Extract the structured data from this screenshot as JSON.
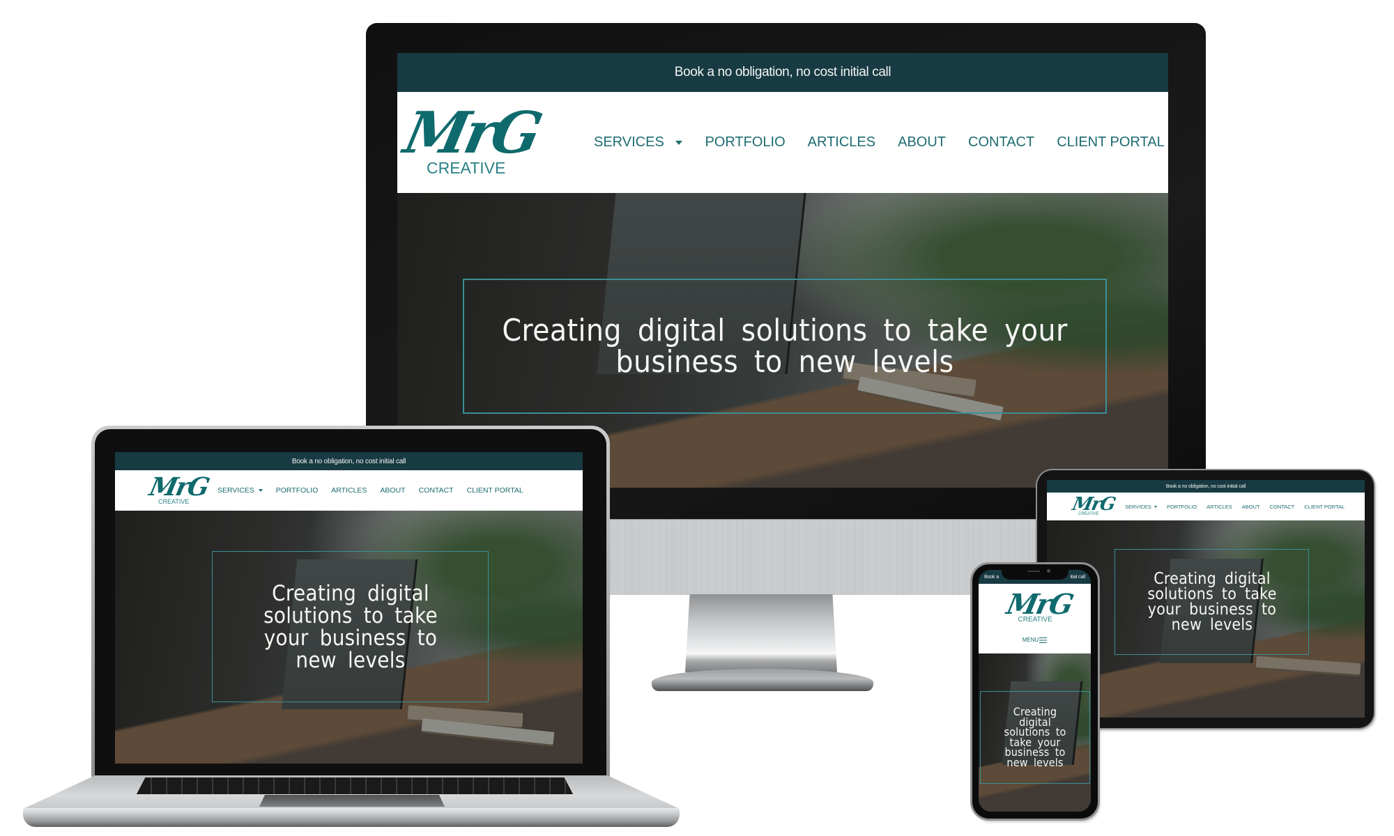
{
  "site": {
    "announcement": "Book a no obligation, no cost initial call",
    "logo": {
      "script_text": "MrG",
      "subtitle": "CREATIVE"
    },
    "nav": [
      {
        "label": "SERVICES",
        "has_dropdown": true
      },
      {
        "label": "PORTFOLIO"
      },
      {
        "label": "ARTICLES"
      },
      {
        "label": "ABOUT"
      },
      {
        "label": "CONTACT"
      },
      {
        "label": "CLIENT PORTAL"
      }
    ],
    "mobile_menu_label": "MENU",
    "hero_headline": "Creating digital solutions to take your business to new levels",
    "phone_topbar_left": "Book a",
    "phone_topbar_right": "itial call",
    "colors": {
      "topbar_bg": "#183a42",
      "brand_teal": "#0f6a6d",
      "nav_text": "#1d6b70",
      "hero_box_border": "#3a8f98"
    }
  },
  "devices": [
    "monitor",
    "laptop",
    "tablet",
    "phone"
  ]
}
